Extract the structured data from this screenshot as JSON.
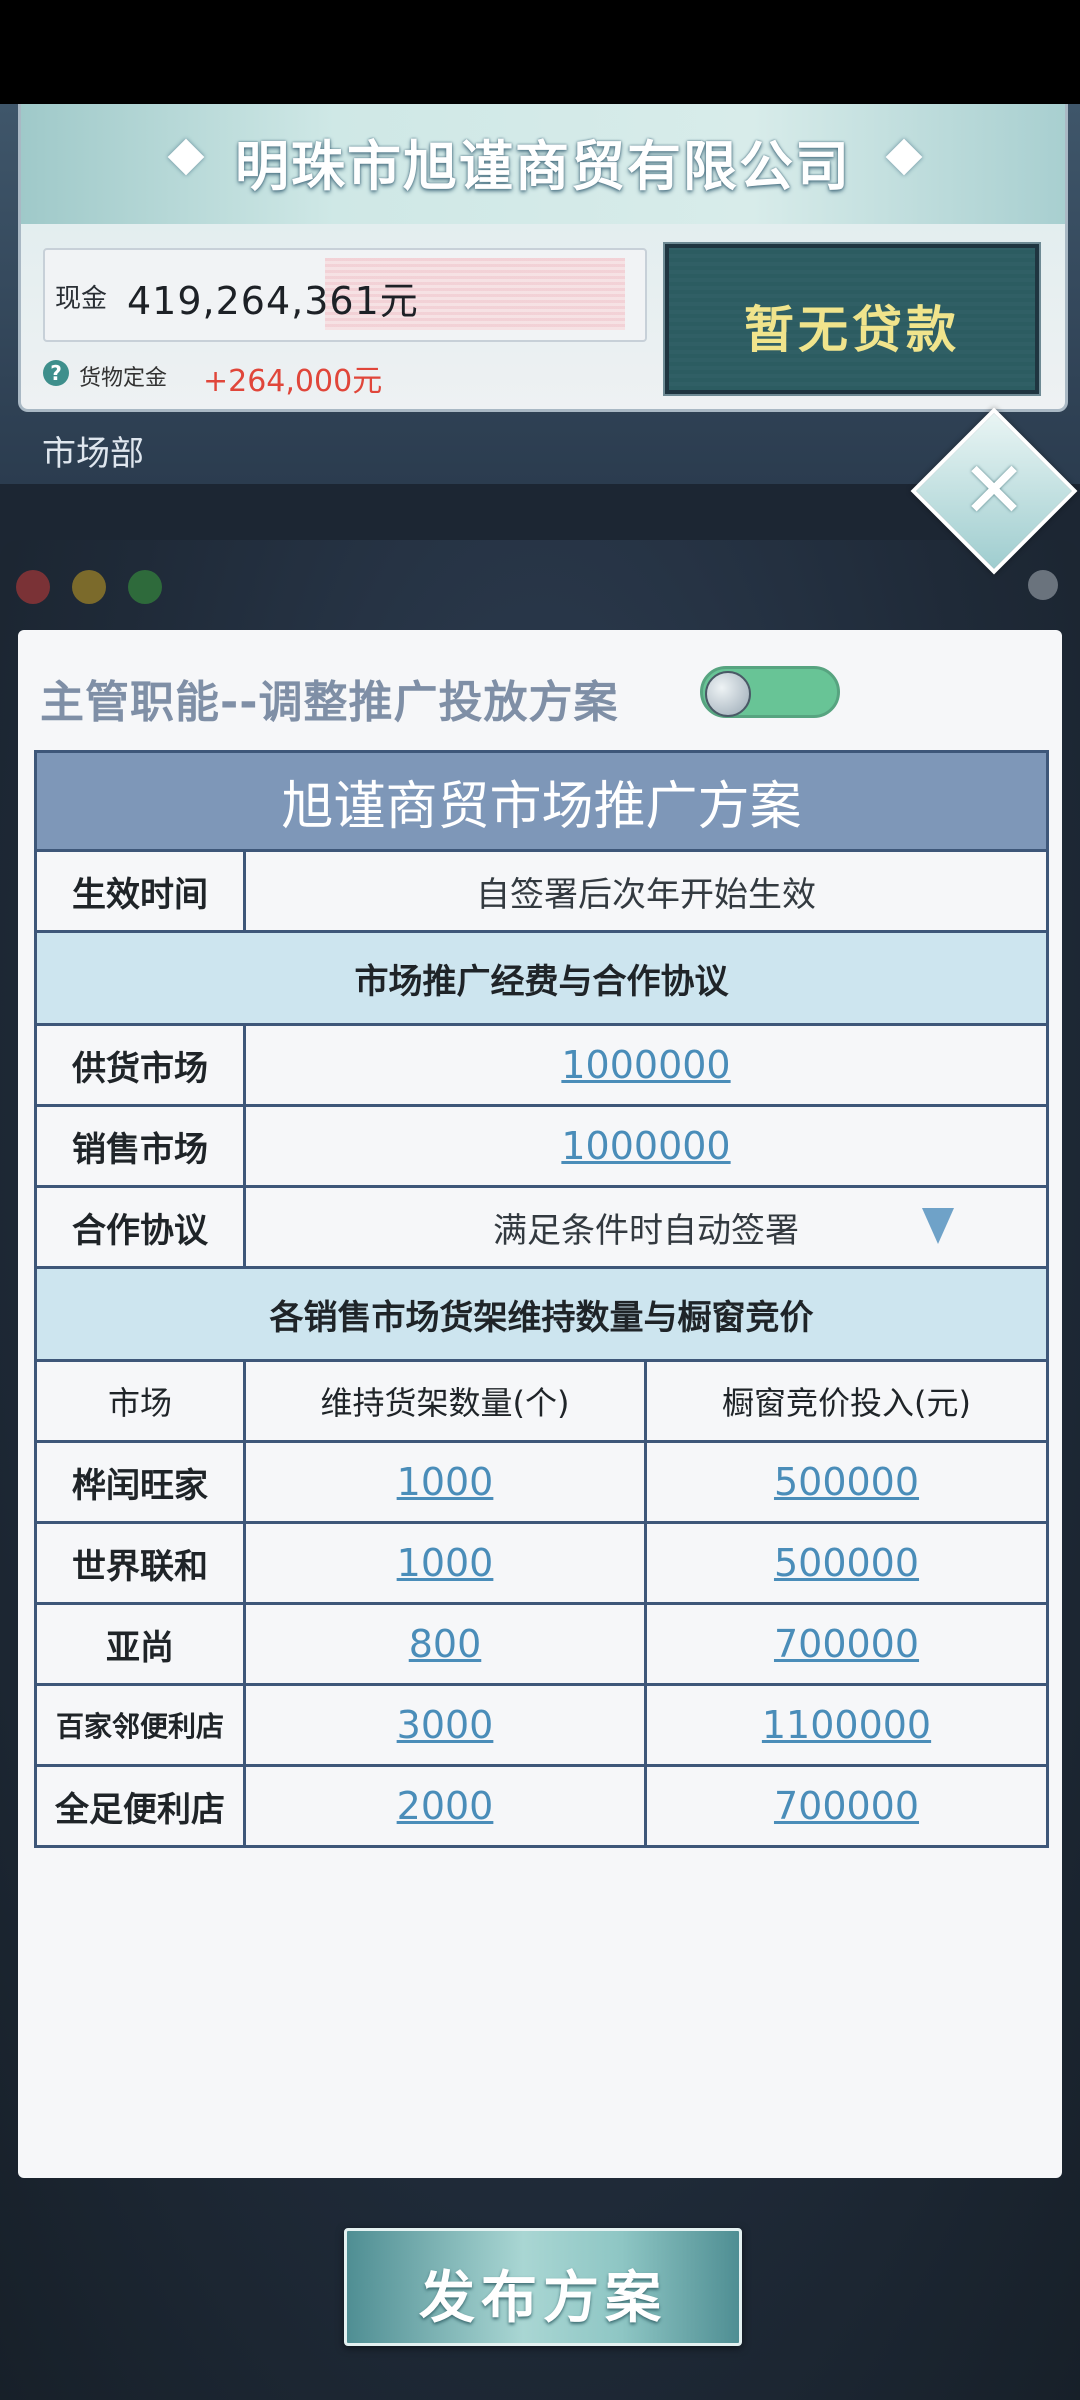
{
  "company": {
    "name": "明珠市旭谨商贸有限公司",
    "cash_label": "现金",
    "cash_value": "419,264,361元",
    "deposit_label": "货物定金",
    "deposit_value": "+264,000元",
    "loan_button_label": "暂无贷款",
    "department": "市场部"
  },
  "dialog": {
    "heading": "主管职能--调整推广投放方案",
    "toggle_on": true
  },
  "plan": {
    "title": "旭谨商贸市场推广方案",
    "effective_label": "生效时间",
    "effective_value": "自签署后次年开始生效",
    "section_fees": "市场推广经费与合作协议",
    "supply_market_label": "供货市场",
    "supply_market_value": "1000000",
    "sales_market_label": "销售市场",
    "sales_market_value": "1000000",
    "agreement_label": "合作协议",
    "agreement_value": "满足条件时自动签署",
    "section_shelves": "各销售市场货架维持数量与橱窗竞价",
    "col_market": "市场",
    "col_shelves": "维持货架数量(个)",
    "col_bid": "橱窗竞价投入(元)",
    "rows": [
      {
        "market": "桦闰旺家",
        "shelves": "1000",
        "bid": "500000"
      },
      {
        "market": "世界联和",
        "shelves": "1000",
        "bid": "500000"
      },
      {
        "market": "亚尚",
        "shelves": "800",
        "bid": "700000"
      },
      {
        "market": "百家邻便利店",
        "shelves": "3000",
        "bid": "1100000"
      },
      {
        "market": "全足便利店",
        "shelves": "2000",
        "bid": "700000"
      }
    ]
  },
  "publish_button_label": "发布方案",
  "colors": {
    "accent_link": "#4a8db9",
    "title_bar": "#7e97b8",
    "section_bar": "#cde5ef",
    "toggle_on": "#68c496",
    "deposit_text": "#e0463a",
    "loan_text": "#f0e48c"
  },
  "icons": {
    "close": "close-icon",
    "help": "help-icon",
    "dropdown": "chevron-down-icon"
  }
}
